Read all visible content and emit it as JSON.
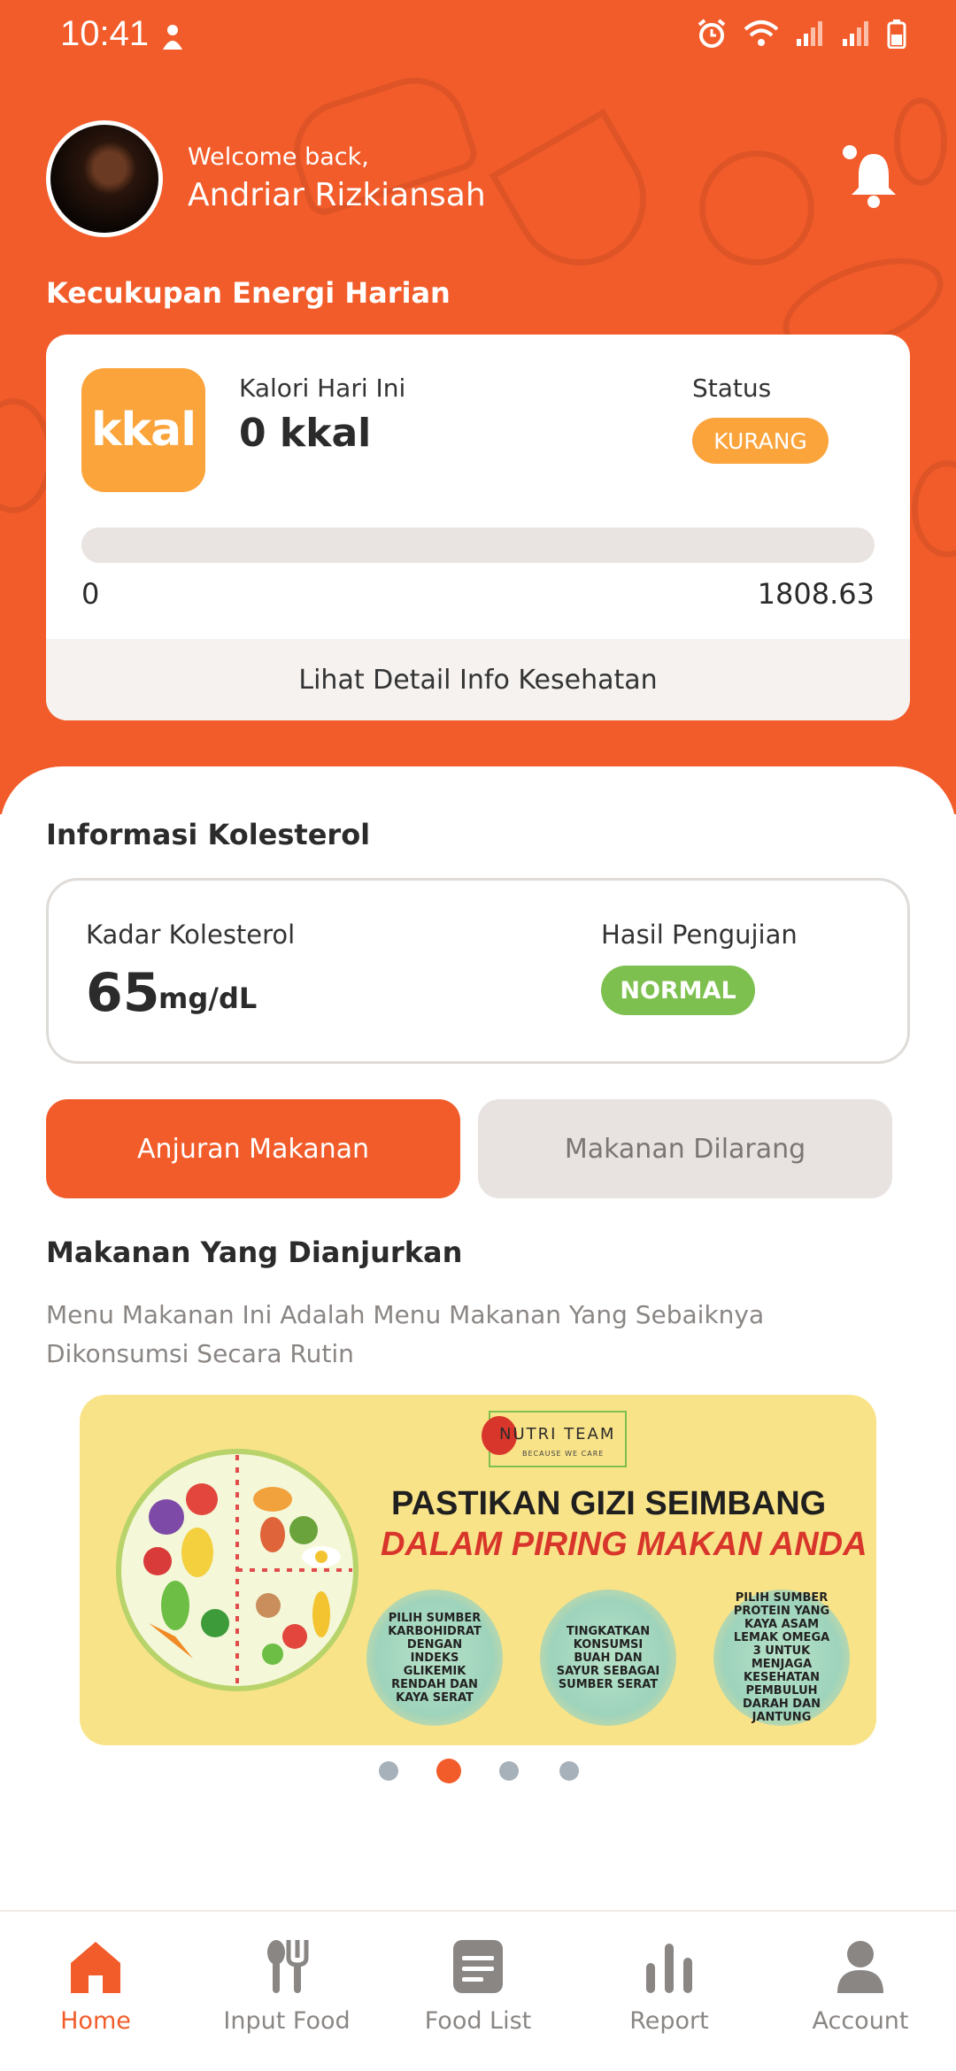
{
  "status_bar": {
    "time": "10:41"
  },
  "header": {
    "welcome": "Welcome back,",
    "user_name": "Andriar Rizkiansah",
    "section_title": "Kecukupan Energi Harian"
  },
  "energy_card": {
    "badge": "kkal",
    "calories_label": "Kalori Hari Ini",
    "calories_value": "0 kkal",
    "status_label": "Status",
    "status_value": "KURANG",
    "progress_fraction": 0,
    "progress_min": "0",
    "progress_max": "1808.63",
    "detail_link": "Lihat Detail Info Kesehatan"
  },
  "cholesterol": {
    "section_title": "Informasi Kolesterol",
    "level_label": "Kadar Kolesterol",
    "level_value": "65",
    "level_unit": "mg/dL",
    "result_label": "Hasil Pengujian",
    "result_value": "NORMAL"
  },
  "tabs": {
    "recommended": "Anjuran Makanan",
    "forbidden": "Makanan Dilarang"
  },
  "recommendations": {
    "title": "Makanan Yang Dianjurkan",
    "description": "Menu Makanan Ini Adalah Menu Makanan Yang Sebaiknya Dikonsumsi Secara Rutin"
  },
  "banner": {
    "brand": "NUTRI TEAM",
    "brand_tagline": "BECAUSE WE CARE",
    "headline_1": "PASTIKAN GIZI SEIMBANG",
    "headline_2": "DALAM PIRING MAKAN ANDA",
    "tips": [
      "PILIH SUMBER KARBOHIDRAT DENGAN INDEKS GLIKEMIK RENDAH DAN KAYA SERAT",
      "TINGKATKAN KONSUMSI BUAH DAN SAYUR SEBAGAI SUMBER SERAT",
      "PILIH SUMBER PROTEIN YANG KAYA ASAM LEMAK OMEGA 3 UNTUK MENJAGA KESEHATAN PEMBULUH DARAH DAN JANTUNG"
    ]
  },
  "carousel": {
    "total": 4,
    "active_index": 1
  },
  "bottom_nav": {
    "items": [
      {
        "label": "Home",
        "icon": "home-icon",
        "active": true
      },
      {
        "label": "Input Food",
        "icon": "cutlery-icon",
        "active": false
      },
      {
        "label": "Food List",
        "icon": "list-icon",
        "active": false
      },
      {
        "label": "Report",
        "icon": "bar-chart-icon",
        "active": false
      },
      {
        "label": "Account",
        "icon": "person-icon",
        "active": false
      }
    ]
  },
  "colors": {
    "primary": "#F25C2A",
    "status_badge": "#FBA43C",
    "normal_badge": "#7EC04F",
    "inactive_nav": "#8a8684"
  }
}
